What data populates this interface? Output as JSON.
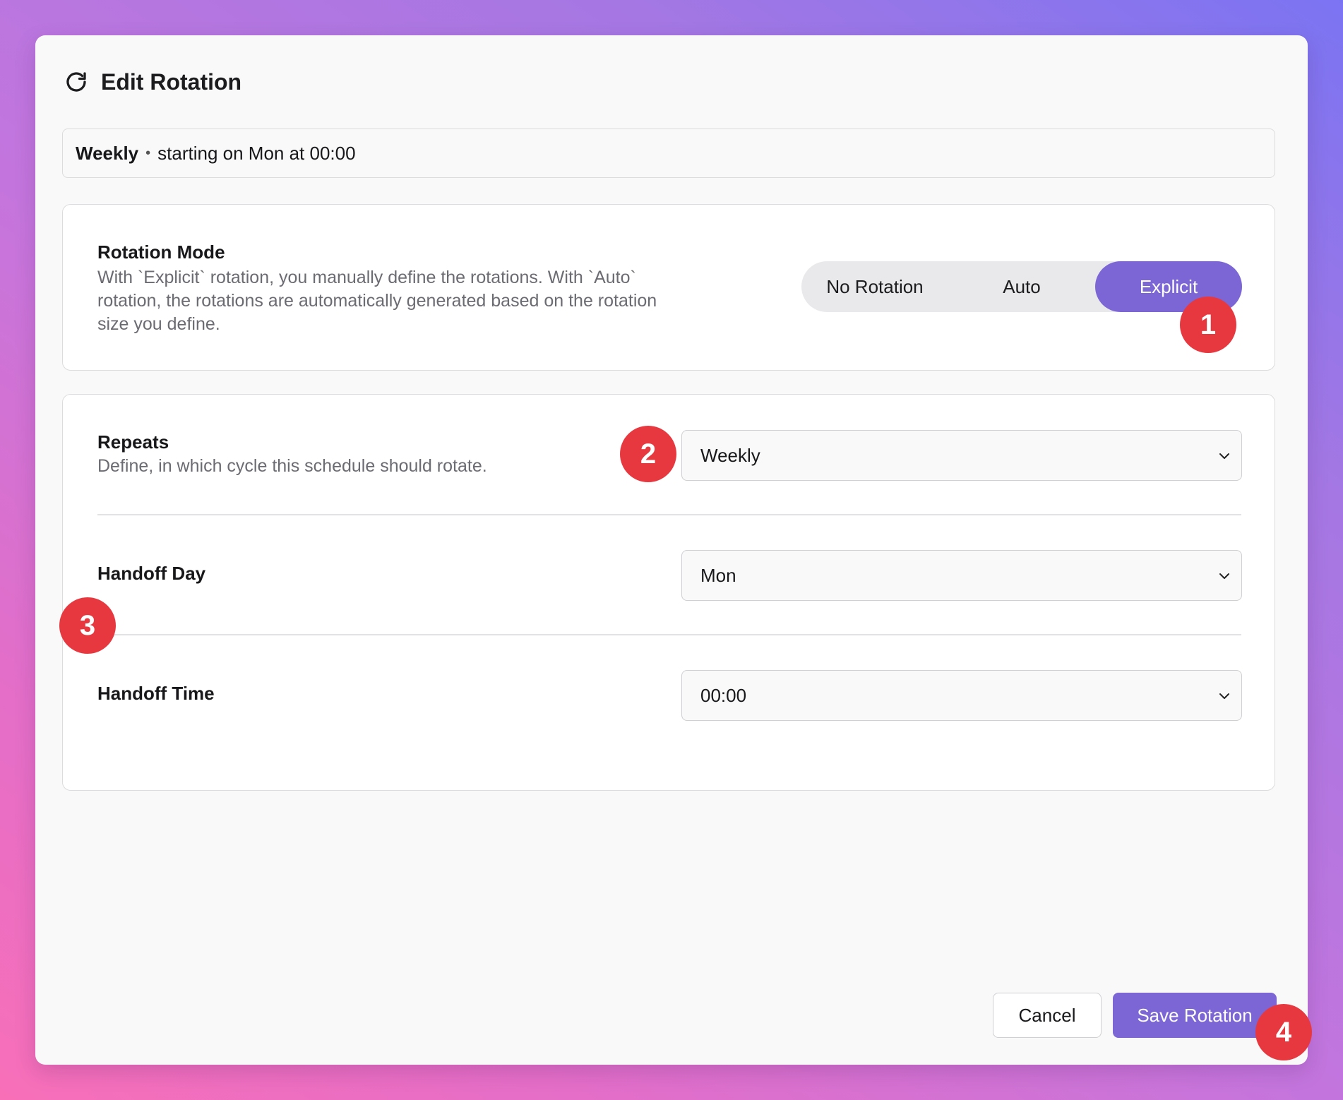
{
  "dialog": {
    "title": "Edit Rotation",
    "icon": "refresh-icon"
  },
  "summary": {
    "frequency": "Weekly",
    "separator": "•",
    "detail": "starting on Mon at 00:00"
  },
  "rotation_mode": {
    "label": "Rotation Mode",
    "description": "With `Explicit` rotation, you manually define the rotations. With `Auto` rotation, the rotations are automatically generated based on the rotation size you define.",
    "options": [
      "No Rotation",
      "Auto",
      "Explicit"
    ],
    "selected": "Explicit"
  },
  "schedule": {
    "repeats": {
      "label": "Repeats",
      "description": "Define, in which cycle this schedule should rotate.",
      "value": "Weekly"
    },
    "handoff_day": {
      "label": "Handoff Day",
      "value": "Mon"
    },
    "handoff_time": {
      "label": "Handoff Time",
      "value": "00:00"
    }
  },
  "footer": {
    "cancel_label": "Cancel",
    "save_label": "Save Rotation"
  },
  "annotations": [
    "1",
    "2",
    "3",
    "4"
  ],
  "colors": {
    "accent": "#7c66d5",
    "badge": "#e8383f"
  }
}
